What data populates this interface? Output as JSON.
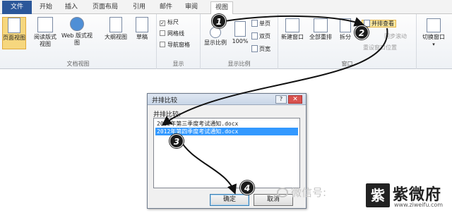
{
  "tabs": [
    "文件",
    "开始",
    "插入",
    "页面布局",
    "引用",
    "邮件",
    "审阅",
    "视图"
  ],
  "groups": {
    "doc_views": {
      "label": "文档视图",
      "buttons": [
        "页面视图",
        "阅读版式视图",
        "Web 版式视图",
        "大纲视图",
        "草稿"
      ]
    },
    "show": {
      "label": "显示",
      "checks": [
        {
          "label": "标尺",
          "checked": true
        },
        {
          "label": "网格线",
          "checked": false
        },
        {
          "label": "导航窗格",
          "checked": false
        }
      ]
    },
    "zoom": {
      "label": "显示比例",
      "buttons": [
        "显示比例",
        "100%"
      ],
      "small": [
        "单页",
        "双页",
        "页宽"
      ]
    },
    "window": {
      "label": "窗口",
      "buttons": [
        "新建窗口",
        "全部重排",
        "拆分"
      ],
      "side_by_side": "并排查看",
      "sync_scroll": "同步滚动",
      "reset_pos": "重设窗口位置",
      "switch": "切换窗口"
    }
  },
  "dialog": {
    "title": "并排比较",
    "help": "?",
    "close": "✕",
    "label": "并排比较:",
    "items": [
      "2012年第三季度考试通知.docx",
      "2012年第四季度考试通知.docx"
    ],
    "selected_index": 1,
    "ok": "确定",
    "cancel": "取消"
  },
  "steps": [
    "1",
    "2",
    "3",
    "4"
  ],
  "watermark": {
    "text": "微信号: ",
    "logo_char": "紫",
    "brand": "紫微府",
    "url": "www.ziweifu.com"
  }
}
